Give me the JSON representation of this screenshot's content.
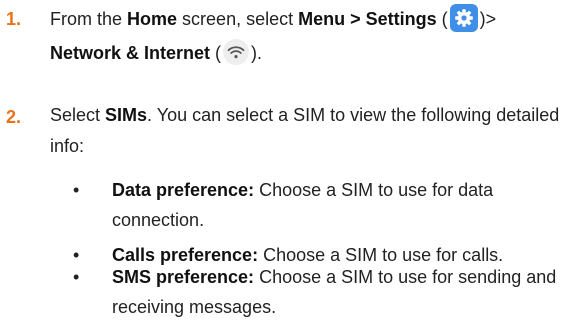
{
  "steps": [
    {
      "number": "1.",
      "parts": {
        "from": "From the ",
        "home": "Home",
        "screen_select": " screen, select ",
        "menu_settings": "Menu > Settings",
        "open_paren": " (",
        "close_paren_gt": ")>",
        "network": "Network & Internet",
        "open_paren2": " (",
        "close_paren2": ")."
      },
      "icons": [
        "gear-icon",
        "wifi-icon"
      ]
    },
    {
      "number": "2.",
      "parts": {
        "select": "Select ",
        "sims": "SIMs",
        "rest": ". You can select a SIM to view the following detailed info:"
      }
    }
  ],
  "bullets": [
    {
      "term": "Data preference:",
      "text": " Choose a SIM to use for data connection."
    },
    {
      "term": "Calls preference:",
      "text": " Choose a SIM to use for calls."
    },
    {
      "term": "SMS preference:",
      "text": " Choose a SIM to use for sending and receiving messages."
    }
  ],
  "colors": {
    "step_number": "#e8731a",
    "settings_icon_bg": "#3f8ee8",
    "text": "#222222"
  }
}
